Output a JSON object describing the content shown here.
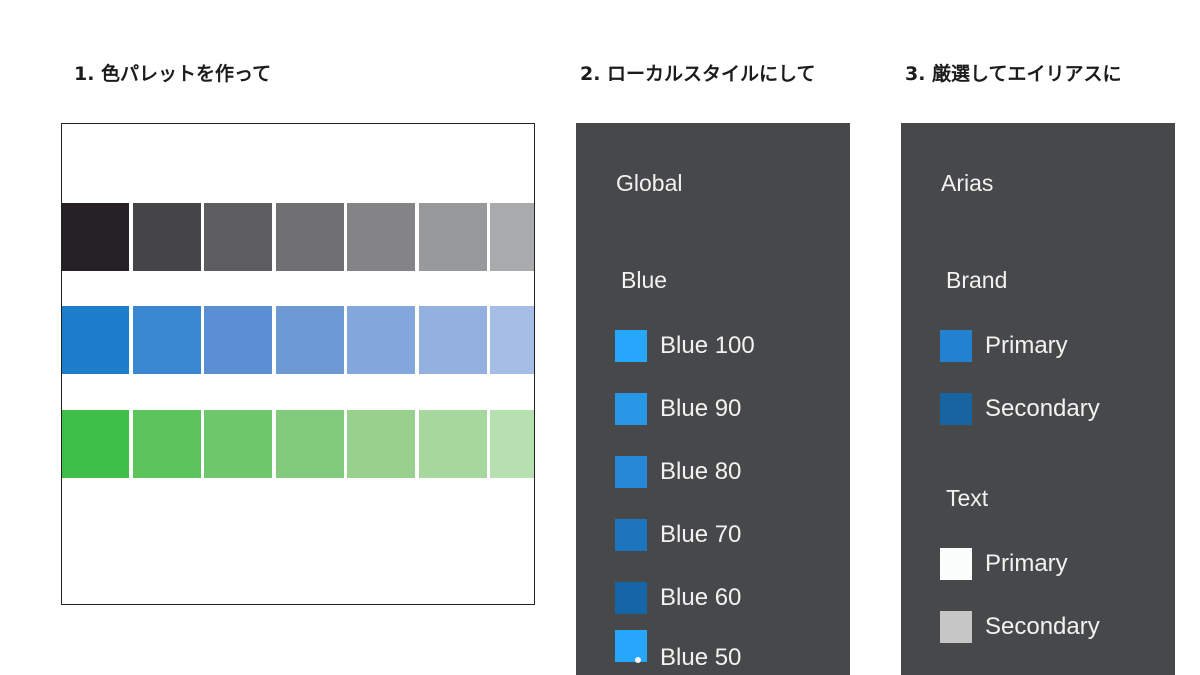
{
  "headings": {
    "step1": "1. 色パレットを作って",
    "step2": "2. ローカルスタイルにして",
    "step3": "3. 厳選してエイリアスに"
  },
  "palette": {
    "rows": [
      {
        "name": "gray",
        "colors": [
          "#252124",
          "#454547",
          "#5d5d5f",
          "#6f6f71",
          "#848486",
          "#98999b",
          "#a9aaac"
        ]
      },
      {
        "name": "blue",
        "colors": [
          "#1d7dcb",
          "#3b88d2",
          "#5a90d3",
          "#6d9ad5",
          "#83a6dc",
          "#93b0e0",
          "#a6bde6"
        ]
      },
      {
        "name": "green",
        "colors": [
          "#3ebf48",
          "#5bc45c",
          "#6ec76a",
          "#83cb7c",
          "#98d18e",
          "#a6d89d",
          "#b6e0b0"
        ]
      }
    ]
  },
  "global_panel": {
    "title": "Global",
    "group": "Blue",
    "items": [
      {
        "label": "Blue 100",
        "color": "#27a7fb"
      },
      {
        "label": "Blue 90",
        "color": "#2897e7"
      },
      {
        "label": "Blue 80",
        "color": "#2587d6"
      },
      {
        "label": "Blue 70",
        "color": "#1d75bd"
      },
      {
        "label": "Blue 60",
        "color": "#1666a7"
      },
      {
        "label": "Blue 50",
        "color": "#27a7fb"
      }
    ]
  },
  "alias_panel": {
    "title": "Arias",
    "groups": [
      {
        "title": "Brand",
        "items": [
          {
            "label": "Primary",
            "color": "#2282cf"
          },
          {
            "label": "Secondary",
            "color": "#1864a0"
          }
        ]
      },
      {
        "title": "Text",
        "items": [
          {
            "label": "Primary",
            "color": "#fbfcfc"
          },
          {
            "label": "Secondary",
            "color": "#c6c6c6"
          }
        ]
      }
    ]
  }
}
